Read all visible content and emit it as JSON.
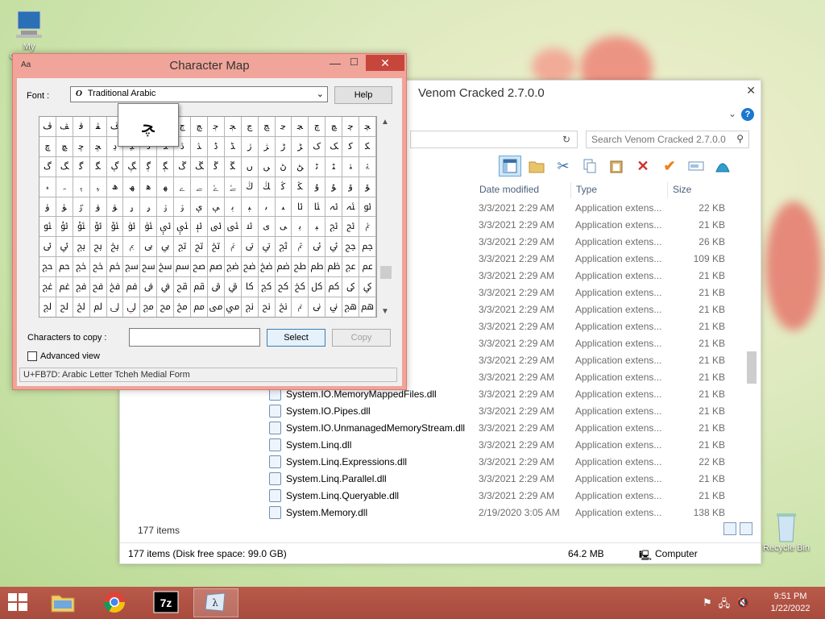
{
  "desktop": {
    "icons": [
      {
        "label": "My Computer"
      },
      {
        "label": "Recycle Bin"
      }
    ]
  },
  "explorer": {
    "title": "Venom Cracked 2.7.0.0",
    "search_placeholder": "Search Venom Cracked 2.7.0.0",
    "columns": {
      "date": "Date modified",
      "type": "Type",
      "size": "Size"
    },
    "rows": [
      {
        "name": "...ars.dll",
        "date": "3/3/2021 2:29 AM",
        "type": "Application extens...",
        "size": "22 KB"
      },
      {
        "name": "",
        "date": "3/3/2021 2:29 AM",
        "type": "Application extens...",
        "size": "21 KB"
      },
      {
        "name": "...ons.dll",
        "date": "3/3/2021 2:29 AM",
        "type": "Application extens...",
        "size": "26 KB"
      },
      {
        "name": "...File.dll",
        "date": "3/3/2021 2:29 AM",
        "type": "Application extens...",
        "size": "109 KB"
      },
      {
        "name": "",
        "date": "3/3/2021 2:29 AM",
        "type": "Application extens...",
        "size": "21 KB"
      },
      {
        "name": "",
        "date": "3/3/2021 2:29 AM",
        "type": "Application extens...",
        "size": "21 KB"
      },
      {
        "name": "",
        "date": "3/3/2021 2:29 AM",
        "type": "Application extens...",
        "size": "21 KB"
      },
      {
        "name": "...fo.dll",
        "date": "3/3/2021 2:29 AM",
        "type": "Application extens...",
        "size": "21 KB"
      },
      {
        "name": "...ves.dll",
        "date": "3/3/2021 2:29 AM",
        "type": "Application extens...",
        "size": "21 KB"
      },
      {
        "name": "...er.dll",
        "date": "3/3/2021 2:29 AM",
        "type": "Application extens...",
        "size": "21 KB"
      },
      {
        "name": "",
        "date": "3/3/2021 2:29 AM",
        "type": "Application extens...",
        "size": "21 KB"
      },
      {
        "name": "System.IO.MemoryMappedFiles.dll",
        "date": "3/3/2021 2:29 AM",
        "type": "Application extens...",
        "size": "21 KB"
      },
      {
        "name": "System.IO.Pipes.dll",
        "date": "3/3/2021 2:29 AM",
        "type": "Application extens...",
        "size": "21 KB"
      },
      {
        "name": "System.IO.UnmanagedMemoryStream.dll",
        "date": "3/3/2021 2:29 AM",
        "type": "Application extens...",
        "size": "21 KB"
      },
      {
        "name": "System.Linq.dll",
        "date": "3/3/2021 2:29 AM",
        "type": "Application extens...",
        "size": "21 KB"
      },
      {
        "name": "System.Linq.Expressions.dll",
        "date": "3/3/2021 2:29 AM",
        "type": "Application extens...",
        "size": "22 KB"
      },
      {
        "name": "System.Linq.Parallel.dll",
        "date": "3/3/2021 2:29 AM",
        "type": "Application extens...",
        "size": "21 KB"
      },
      {
        "name": "System.Linq.Queryable.dll",
        "date": "3/3/2021 2:29 AM",
        "type": "Application extens...",
        "size": "21 KB"
      },
      {
        "name": "System.Memory.dll",
        "date": "2/19/2020 3:05 AM",
        "type": "Application extens...",
        "size": "138 KB"
      }
    ],
    "item_count": "177 items",
    "status": {
      "summary": "177 items (Disk free space: 99.0 GB)",
      "size": "64.2 MB",
      "location": "Computer"
    }
  },
  "charmap": {
    "title": "Character Map",
    "font_label": "Font :",
    "font_value": "Traditional Arabic",
    "help_label": "Help",
    "zoom_char": "ﭽ",
    "chars": "ﭪﭫﭬﭭﭮﭯﭰﭱﭲﭳﭴﭵﭶﭷﭸﭹﭺﭻﭼﭽﭾﭿﮀﮁﮂﮃﮄﮅﮆﮇﮈﮉﮊﮋﮌﮍﮎﮏﮐﮑﮒﮓﮔﮕﮖﮗﮘﮙﮚﮛﮜﮝﮞﮟﮠﮡﮢﮣﮤﮥﮦﮧﮨﮩﮪﮫﮬﮭﮮﮯﮰﮱﯓﯔﯕﯖﯗﯘﯙﯚﯛﯜﯝﯞﯟﯠﯡﯢﯣﯤﯥﯦﯧﯨﯩﯪﯫﯬﯭﯮﯯﯰﯱﯲﯳﯴﯵﯶﯷﯸﯹﯺﯻﯼﯽﯾﯿﰀﰁﰂﰃﰄﰅﰆﰇﰈﰉﰊﰋﰌﰍﰎﰏﰐﰑﰒﰓﰔﰕﰖﰗﰘﰙﰚﰛﰜﰝﰞﰟﰠﰡﰢﰣﰤﰥﰦﰧﰨﰩﰪﰫﰬﰭﰮﰯﰰﰱﰲﰳﰴﰵﰶﰷﰸﰹﰺﰻﰼﰽﰾﰿﱀﱁﱂﱃﱄﱅﱆﱇﱈﱉﱊﱋﱌﱍﱎﱏﱐﱑﱒﱓﱔﱕﱖﱗﱘﱙﱚﱛﱜﱝﱞﱟﱠﱡﱢﱣﱤﱥﱦﱧﱨﱩﱪﱫﱬﱭﱮﱯﱰﱱﱲﱳﱴﱵﱶﱷﱸﱹﱺﱻﱼﱽﱾﱿﲀﲁﲂﲃﲄﲅﲆﲇﲈﲉﲊﲋﲌﲍﲎﲏﲐﲑﲒﲓﲔﲕﲖﲗﲘﲙ",
    "copy_label": "Characters to copy :",
    "select_label": "Select",
    "copy_button": "Copy",
    "advanced_label": "Advanced view",
    "status": "U+FB7D: Arabic Letter Tcheh Medial Form"
  },
  "taskbar": {
    "clock_time": "9:51 PM",
    "clock_date": "1/22/2022",
    "apps": [
      "file-explorer",
      "chrome",
      "7zip",
      "character-map"
    ]
  },
  "colors": {
    "accent": "#c7463c",
    "charmap_frame": "#f0a49a",
    "taskbar": "#b45547"
  }
}
